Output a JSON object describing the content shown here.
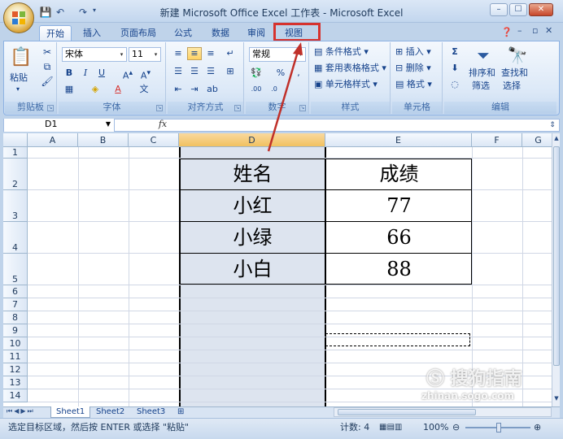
{
  "window": {
    "title": "新建 Microsoft Office Excel 工作表 - Microsoft Excel",
    "min": "–",
    "max": "☐",
    "close": "✕"
  },
  "tabs": [
    {
      "label": "开始",
      "active": true
    },
    {
      "label": "插入"
    },
    {
      "label": "页面布局"
    },
    {
      "label": "公式"
    },
    {
      "label": "数据"
    },
    {
      "label": "审阅"
    },
    {
      "label": "视图"
    }
  ],
  "ribbon": {
    "clipboard": {
      "paste": "粘贴",
      "group": "剪贴板"
    },
    "font": {
      "name": "宋体",
      "size": "11",
      "group": "字体"
    },
    "align": {
      "group": "对齐方式"
    },
    "number": {
      "format": "常规",
      "group": "数字"
    },
    "styles": {
      "cond": "条件格式",
      "table": "套用表格格式",
      "cell": "单元格样式",
      "group": "样式"
    },
    "cells": {
      "insert": "插入",
      "delete": "删除",
      "format": "格式",
      "group": "单元格"
    },
    "editing": {
      "sort": "排序和",
      "filter": "筛选",
      "find": "查找和",
      "select": "选择",
      "group": "编辑"
    }
  },
  "formula": {
    "namebox": "D1",
    "fx": "fx"
  },
  "columns": [
    "A",
    "B",
    "C",
    "D",
    "E",
    "F",
    "G"
  ],
  "rows": [
    "1",
    "2",
    "3",
    "4",
    "5",
    "6",
    "7",
    "8",
    "9",
    "10",
    "11",
    "12",
    "13",
    "14"
  ],
  "table": {
    "headers": [
      "姓名",
      "成绩"
    ],
    "rows": [
      [
        "小红",
        "77"
      ],
      [
        "小绿",
        "66"
      ],
      [
        "小白",
        "88"
      ]
    ]
  },
  "sheets": [
    "Sheet1",
    "Sheet2",
    "Sheet3"
  ],
  "status": {
    "message": "选定目标区域，然后按 ENTER 或选择 \"粘贴\"",
    "count": "计数: 4",
    "zoom": "100%"
  },
  "watermark": "搜狗指南",
  "watermark_url": "zhinan.sogo.com",
  "colors": {
    "highlight_box": "#d6322e",
    "arrow": "#c0302a"
  }
}
